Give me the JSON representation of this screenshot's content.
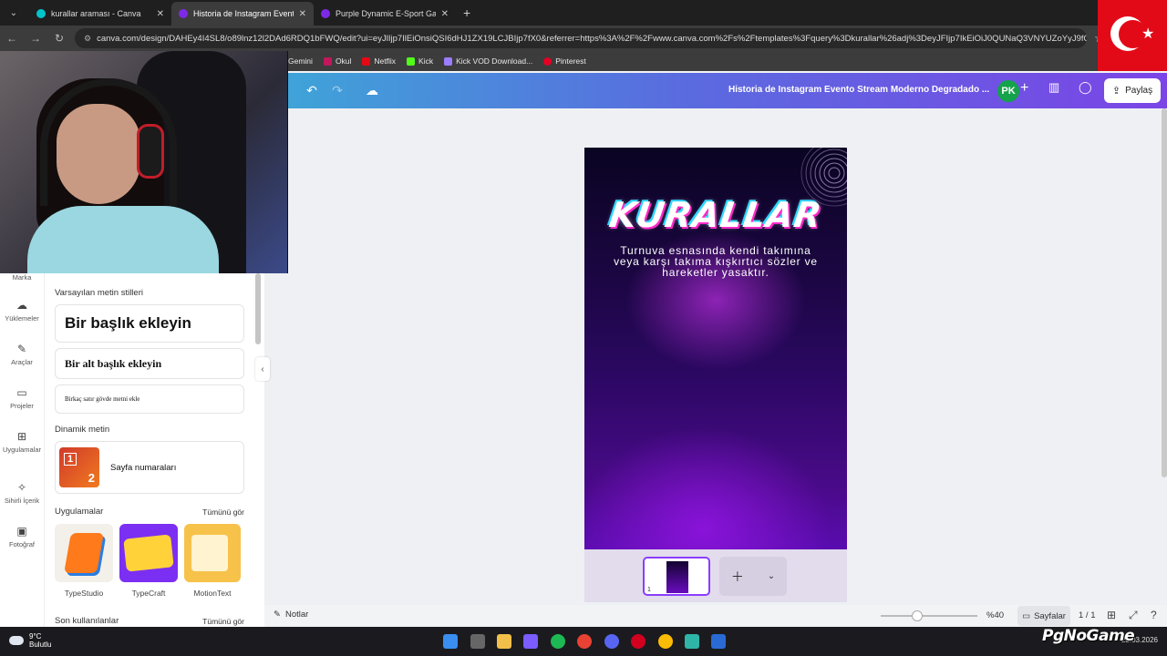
{
  "browser": {
    "tabs": [
      {
        "label": "kurallar araması - Canva",
        "favicon_color": "#00c4cc",
        "active": false
      },
      {
        "label": "Historia de Instagram Evento St",
        "favicon_color": "#7d2ae8",
        "active": true
      },
      {
        "label": "Purple Dynamic E-Sport Game",
        "favicon_color": "#7d2ae8",
        "active": false
      }
    ],
    "url": "canva.com/design/DAHEy4I4SL8/o89lnz12l2DAd6RDQ1bFWQ/edit?ui=eyJlIjp7IlEiOnsiQSI6dHJ1ZX19LCJBIjp7fX0&referrer=https%3A%2F%2Fwww.canva.com%2Fs%2Ftemplates%3Fquery%3Dkurallar%26adj%3DeyJFIjp7IkEiOiJ0QUNaQ3VNYUZoYyJ9fQ",
    "bookmarks": [
      {
        "label": "Gemini",
        "color": "#3c3c3c"
      },
      {
        "label": "Okul",
        "color": "#c2185b"
      },
      {
        "label": "Netflix",
        "color": "#e50914"
      },
      {
        "label": "Kick",
        "color": "#53fc18"
      },
      {
        "label": "Kick VOD Download...",
        "color": "#9c7cff"
      },
      {
        "label": "Pinterest",
        "color": "#e60023"
      }
    ]
  },
  "canva_header": {
    "doc_title": "Historia de Instagram Evento Stream Moderno Degradado ...",
    "avatar_initials": "PK",
    "share_label": "Paylaş"
  },
  "left_rail": {
    "items": [
      "Marka",
      "Yüklemeler",
      "Araçlar",
      "Projeler",
      "Uygulamalar",
      "Sihirli İçerik",
      "Fotoğraf"
    ]
  },
  "text_panel": {
    "section_default": "Varsayılan metin stilleri",
    "heading": "Bir başlık ekleyin",
    "subheading": "Bir alt başlık ekleyin",
    "body": "Birkaç satır gövde metni ekle",
    "section_dynamic": "Dinamik metin",
    "page_numbers": "Sayfa numaraları",
    "page_numbers_digits": [
      "1",
      "2"
    ],
    "section_apps": "Uygulamalar",
    "see_all": "Tümünü gör",
    "apps": [
      "TypeStudio",
      "TypeCraft",
      "MotionText"
    ],
    "section_recent": "Son kullanılanlar"
  },
  "design": {
    "title": "KURALLAR",
    "body": "Turnuva esnasında kendi takımına veya karşı takıma kışkırtıcı sözler ve hareketler yasaktır.",
    "page_thumb_number": "1"
  },
  "bottom_bar": {
    "notes_label": "Notlar",
    "zoom_label": "%40",
    "zoom_level_percent": 40,
    "pages_label": "Sayfalar",
    "page_count": "1 / 1"
  },
  "taskbar": {
    "temperature": "9°C",
    "weather": "Bulutlu",
    "date": "23.03.2026"
  },
  "watermark": "PgNoGame",
  "colors": {
    "canva_purple": "#8b3dff",
    "share_bg": "#ffffff",
    "header_gradient_start": "#3fa3d8",
    "header_gradient_end": "#7b45e6"
  }
}
